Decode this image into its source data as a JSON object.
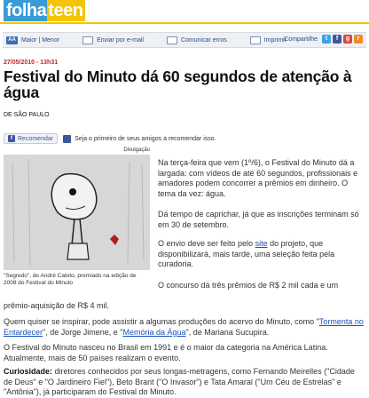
{
  "brand": {
    "logo_part1": "folha",
    "logo_part2": "teen"
  },
  "toolbar": {
    "font_size_label": "Maior | Menor",
    "font_size_icon": "AA",
    "email_label": "Enviar por e-mail",
    "report_error_label": "Comunicar erros",
    "print_label": "Imprimir",
    "share_label": "Compartilhe",
    "social_icons": [
      "twitter-icon",
      "facebook-icon",
      "google-icon",
      "rss-icon"
    ]
  },
  "article": {
    "date": "27/05/2010 - 13h31",
    "headline": "Festival do Minuto dá 60 segundos de atenção à água",
    "byline": "DE SÃO PAULO",
    "recommend_button": "Recomendar",
    "recommend_text": "Seja o primeiro de seus amigos a recomendar isso.",
    "photo_credit": "Divulgação",
    "photo_caption": "\"Segredo\", de André Catoto, premiado na edição de 2008 do Festival do Minuto",
    "p1": "Na terça-feira que vem (1º/6), o Festival do Minuto dá a largada: com vídeos de até 60 segundos, profissionais e amadores podem concorrer a prêmios em dinheiro. O tema da vez: água.",
    "p2": "Dá tempo de caprichar, já que as inscrições terminam só em 30 de setembro.",
    "p3_before": "O envio deve ser feito pelo ",
    "p3_link": "site",
    "p3_after": " do projeto, que disponibilizará, mais tarde, uma seleção feita pela curadoria.",
    "p4a": "O concurso dá três prêmios de R$ 2 mil cada e um",
    "p4b": "prêmio-aquisição de R$ 4 mil.",
    "p5_before": "Quem quiser se inspirar, pode assistir a algumas produções do acervo do Minuto, como \"",
    "p5_link1": "Tormenta no Entardecer",
    "p5_mid": "\", de Jorge Jimene, e \"",
    "p5_link2": "Memória da Água",
    "p5_after": "\", de Mariana Sucupira.",
    "p6": "O Festival do Minuto nasceu no Brasil em 1991 e é o maior da categoria na América Latina. Atualmente, mais de 50 países realizam o evento.",
    "p7_label": "Curiosidade:",
    "p7": " diretores conhecidos por seus longas-metragens, como Fernando Meirelles (\"Cidade de Deus\" e \"O Jardineiro Fiel\"), Beto Brant (\"O Invasor\") e Tata Amaral (\"Um Céu de Estrelas\" e \"Antônia\"), já participaram do Festival do Minuto."
  },
  "colors": {
    "brand_blue": "#3a9bd6",
    "brand_yellow": "#f4c400",
    "date_red": "#c0262b",
    "link_blue": "#1a53b8"
  }
}
